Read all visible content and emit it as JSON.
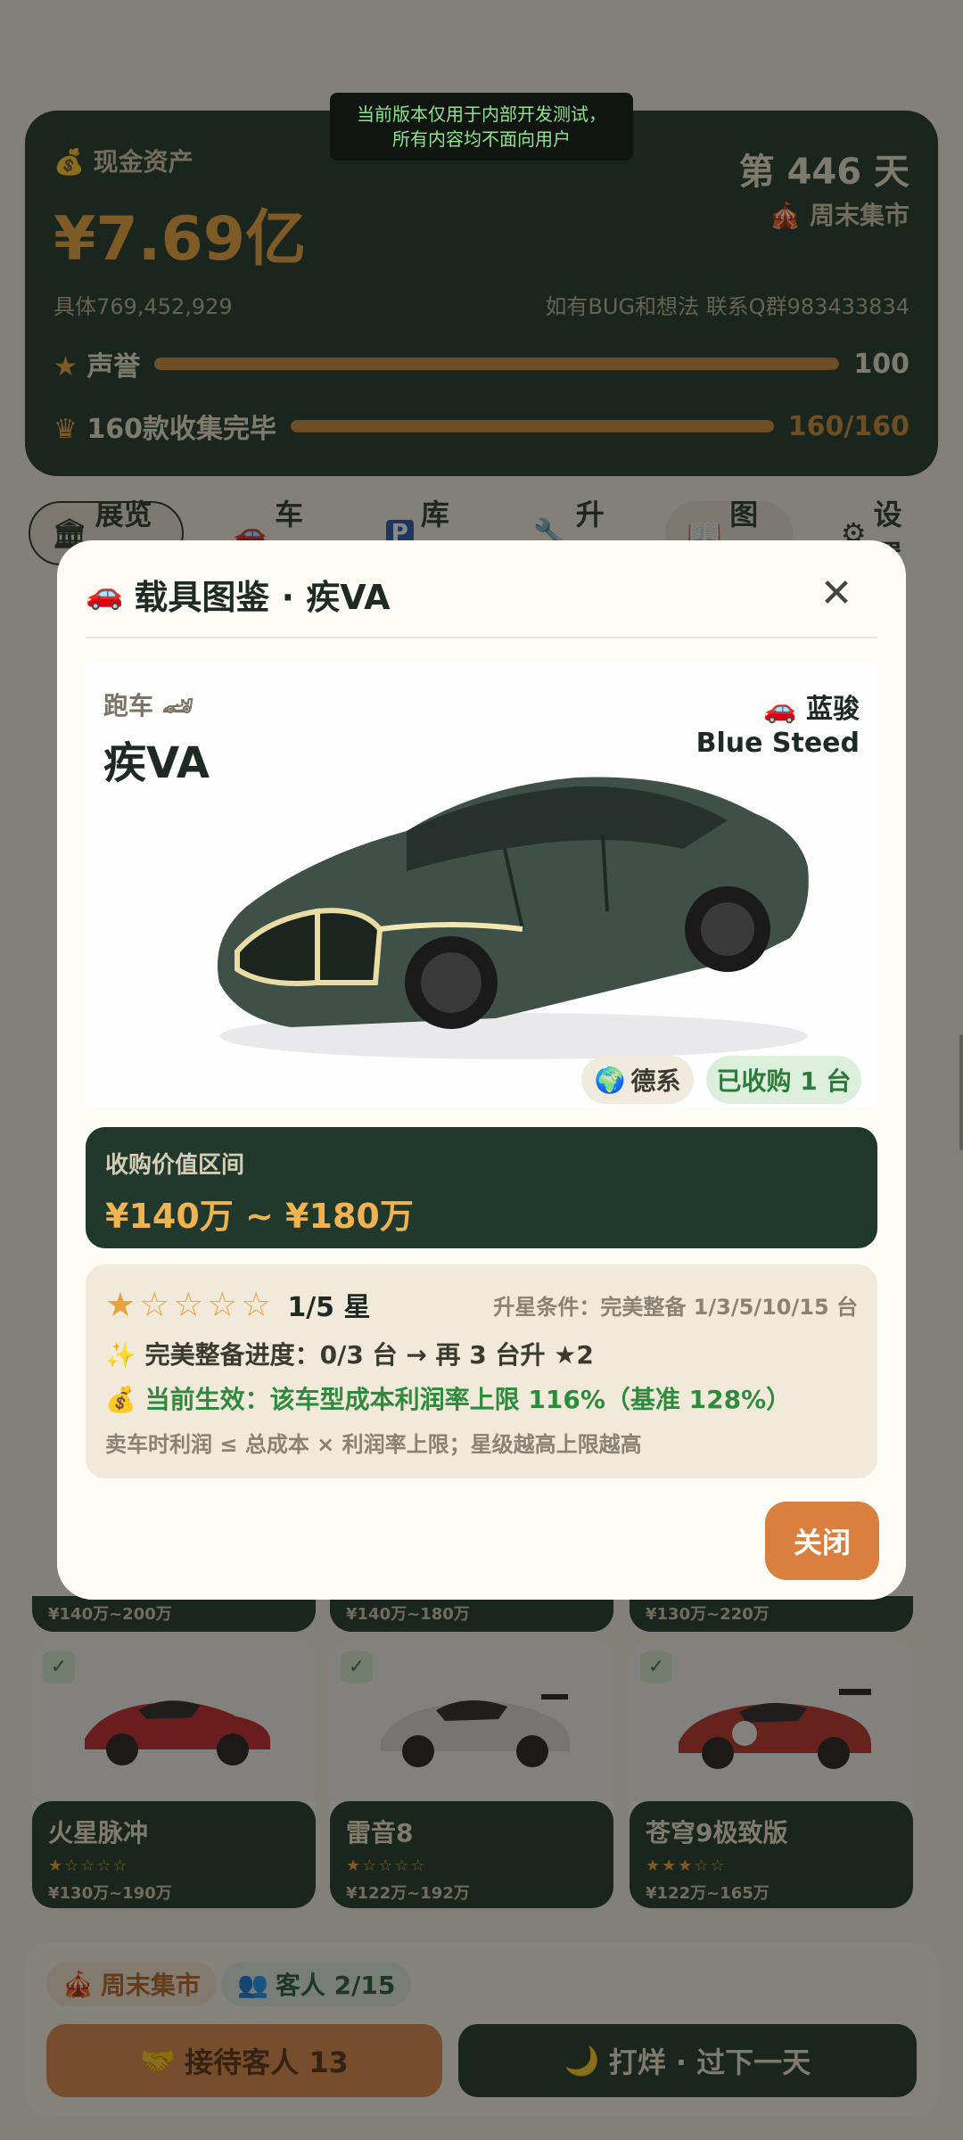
{
  "status_bar": {
    "dev_notice_line1": "当前版本仅用于内部开发测试，",
    "dev_notice_line2": "所有内容均不面向用户"
  },
  "top_card": {
    "cash_icon": "money-bag-icon",
    "cash_label": "现金资产",
    "cash_value": "¥7.69亿",
    "day_label": "第 446 天",
    "market_label": "周末集市",
    "cash_exact": "具体769,452,929",
    "contact": "如有BUG和想法 联系Q群983433834",
    "reputation_label": "声誉",
    "reputation_value": "100",
    "reputation_fraction": 1.0,
    "collection_label": "160款收集完毕",
    "collection_value": "160/160",
    "collection_fraction": 1.0
  },
  "nav": {
    "tabs": [
      {
        "label": "展览馆",
        "icon": "museum-icon"
      },
      {
        "label": "车源",
        "icon": "car-icon"
      },
      {
        "label": "库存",
        "icon": "parking-icon"
      },
      {
        "label": "升级",
        "icon": "wrench-icon"
      },
      {
        "label": "图鉴",
        "icon": "book-icon"
      },
      {
        "label": "设置",
        "icon": "gear-icon"
      }
    ]
  },
  "grid": {
    "strips": [
      {
        "price": "¥140万~200万"
      },
      {
        "price": "¥140万~180万"
      },
      {
        "price": "¥130万~220万"
      }
    ],
    "cards": [
      {
        "name": "火星脉冲",
        "stars": "★☆☆☆☆",
        "price": "¥130万~190万",
        "color": "#c0292b"
      },
      {
        "name": "雷音8",
        "stars": "★☆☆☆☆",
        "price": "¥122万~192万",
        "color": "#d9d9d9"
      },
      {
        "name": "苍穹9极致版",
        "stars": "★★★☆☆",
        "price": "¥122万~165万",
        "color": "#b8332d"
      }
    ]
  },
  "bottom_bar": {
    "market_pill": "周末集市",
    "guests_pill": "客人 2/15",
    "serve_button": "接待客人 13",
    "next_day_button": "打烊 · 过下一天"
  },
  "modal": {
    "title": "载具图鉴 · 疾VA",
    "vehicle_type": "跑车",
    "vehicle_name": "疾VA",
    "brand_cn": "蓝骏",
    "brand_en": "Blue Steed",
    "car_color": "#3e5048",
    "origin_chip": "德系",
    "owned_chip": "已收购 1 台",
    "value_label": "收购价值区间",
    "value_range": "¥140万 ~ ¥180万",
    "stars": "★☆☆☆☆",
    "star_level": "1/5 星",
    "upgrade_condition": "升星条件：完美整备 1/3/5/10/15 台",
    "progress_line": "完美整备进度：0/3 台 → 再 3 台升 ★2",
    "effect_line": "当前生效：该车型成本利润率上限 116%（基准 128%）",
    "note_line": "卖车时利润 ≤ 总成本 × 利润率上限；星级越高上限越高",
    "close_button": "关闭"
  }
}
